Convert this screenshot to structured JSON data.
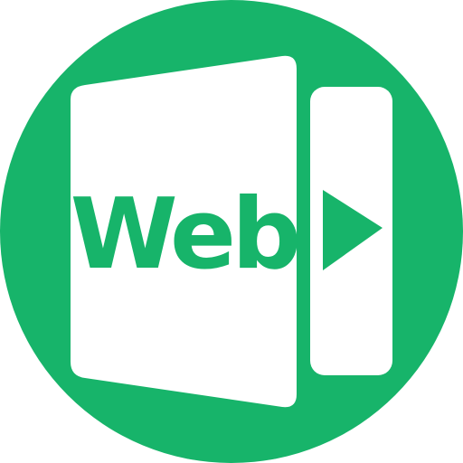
{
  "icon": {
    "name": "web-document-icon",
    "label": "Web",
    "colors": {
      "background_circle": "#17B46A",
      "shape_fill": "#FFFFFF",
      "label_text": "#17B46A",
      "play_arrow": "#17B46A"
    }
  }
}
